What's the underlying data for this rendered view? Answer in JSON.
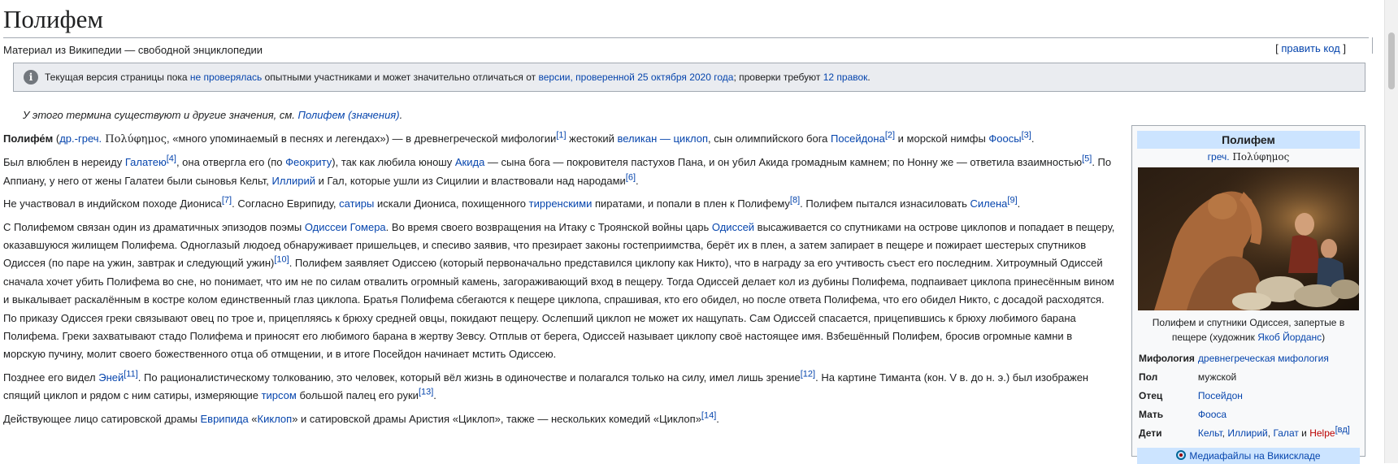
{
  "title": "Полифем",
  "tagline": "Материал из Википедии — свободной энциклопедии",
  "edit": {
    "open": "[ ",
    "label": "править код",
    "close": " ]"
  },
  "notice": {
    "t1": "Текущая версия страницы пока ",
    "l1": "не проверялась",
    "t2": " опытными участниками и может значительно отличаться от ",
    "l2": "версии, проверенной 25 октября 2020 года",
    "t3": "; проверки требуют ",
    "l3": "12 правок",
    "t4": "."
  },
  "hatnote": {
    "text": "У этого термина существуют и другие значения, см. ",
    "link": "Полифем (значения)",
    "end": "."
  },
  "p1": {
    "b": "Полифе́м",
    "t1": " (",
    "l1": "др.-греч.",
    "greek": " Πολύφημος",
    "t2": ", «много упоминаемый в песнях и легендах») — в древнегреческой мифологии",
    "s1": "[1]",
    "t3": " жестокий ",
    "l2": "великан — циклоп",
    "t4": ", сын олимпийского бога ",
    "l3": "Посейдона",
    "s2": "[2]",
    "t5": " и морской нимфы ",
    "l4": "Фоосы",
    "s3": "[3]",
    "t6": "."
  },
  "p2": {
    "t1": "Был влюблен в нереиду ",
    "l1": "Галатею",
    "s1": "[4]",
    "t2": ", она отвергла его (по ",
    "l2": "Феокриту",
    "t3": "), так как любила юношу ",
    "l3": "Акида",
    "t4": " — сына бога — покровителя пастухов Пана, и он убил Акида громадным камнем; по Нонну же — ответила взаимностью",
    "s2": "[5]",
    "t5": ". По Аппиану, у него от жены Галатеи были сыновья Кельт, ",
    "l4": "Иллирий",
    "t6": " и Гал, которые ушли из Сицилии и властвовали над народами",
    "s3": "[6]",
    "t7": "."
  },
  "p3": {
    "t1": "Не участвовал в индийском походе Диониса",
    "s1": "[7]",
    "t2": ". Согласно Еврипиду, ",
    "l1": "сатиры",
    "t3": " искали Диониса, похищенного ",
    "l2": "тирренскими",
    "t4": " пиратами, и попали в плен к Полифему",
    "s2": "[8]",
    "t5": ". Полифем пытался изнасиловать ",
    "l3": "Силена",
    "s3": "[9]",
    "t6": "."
  },
  "p4": {
    "t1": "С Полифемом связан один из драматичных эпизодов поэмы ",
    "l1": "Одиссеи Гомера",
    "t2": ". Во время своего возвращения на Итаку с Троянской войны царь ",
    "l2": "Одиссей",
    "t3": " высаживается со спутниками на острове циклопов и попадает в пещеру, оказавшуюся жилищем Полифема. Одноглазый людоед обнаруживает пришельцев, и спесиво заявив, что презирает законы гостеприимства, берёт их в плен, а затем запирает в пещере и пожирает шестерых спутников Одиссея (по паре на ужин, завтрак и следующий ужин)",
    "s1": "[10]",
    "t4": ". Полифем заявляет Одиссею (который первоначально представился циклопу как Никто), что в награду за его учтивость съест его последним. Хитроумный Одиссей сначала хочет убить Полифема во сне, но понимает, что им не по силам отвалить огромный камень, загораживающий вход в пещеру. Тогда Одиссей делает кол из дубины Полифема, подпаивает циклопа принесённым вином и выкалывает раскалённым в костре колом единственный глаз циклопа. Братья Полифема сбегаются к пещере циклопа, спрашивая, кто его обидел, но после ответа Полифема, что его обидел Никто, с досадой расходятся. По приказу Одиссея греки связывают овец по трое и, прицепляясь к брюху средней овцы, покидают пещеру. Ослепший циклоп не может их нащупать. Сам Одиссей спасается, прицепившись к брюху любимого барана Полифема. Греки захватывают стадо Полифема и приносят его любимого барана в жертву Зевсу. Отплыв от берега, Одиссей называет циклопу своё настоящее имя. Взбешённый Полифем, бросив огромные камни в морскую пучину, молит своего божественного отца об отмщении, и в итоге Посейдон начинает мстить Одиссею."
  },
  "p5": {
    "t1": "Позднее его видел ",
    "l1": "Эней",
    "s1": "[11]",
    "t2": ". По рационалистическому толкованию, это человек, который вёл жизнь в одиночестве и полагался только на силу, имел лишь зрение",
    "s2": "[12]",
    "t3": ". На картине Тиманта (кон. V в. до н. э.) был изображен спящий циклоп и рядом с ним сатиры, измеряющие ",
    "l2": "тирсом",
    "t4": " большой палец его руки",
    "s3": "[13]",
    "t5": "."
  },
  "p6": {
    "t1": "Действующее лицо сатировской драмы ",
    "l1": "Еврипида",
    "t2": " «",
    "l2": "Киклоп",
    "t3": "» и сатировской драмы Аристия «Циклоп», также — нескольких комедий «Циклоп»",
    "s1": "[14]",
    "t4": "."
  },
  "infobox": {
    "title": "Полифем",
    "greek_link": "греч.",
    "greek": " Πολύφημος",
    "caption1": "Полифем и спутники Одиссея, запертые в пещере (художник ",
    "caption_link": "Якоб Йорданс",
    "caption2": ")",
    "rows": {
      "myth": {
        "label": "Мифология",
        "value": "древнегреческая мифология"
      },
      "sex": {
        "label": "Пол",
        "value": "мужской"
      },
      "father": {
        "label": "Отец",
        "value": "Посейдон"
      },
      "mother": {
        "label": "Мать",
        "value": "Фооса"
      },
      "children": {
        "label": "Дети",
        "v1": "Кельт",
        "c1": ", ",
        "v2": "Иллирий",
        "c2": ", ",
        "v3": "Галат",
        "c3": " и ",
        "v4": "Helpe",
        "sup": "[вд]"
      }
    },
    "media": "Медиафайлы на Викискладе"
  },
  "colors": {
    "link": "#0645ad",
    "redlink": "#ba0000",
    "notice_bg": "#eaecf0",
    "infobox_header": "#cce4ff"
  }
}
